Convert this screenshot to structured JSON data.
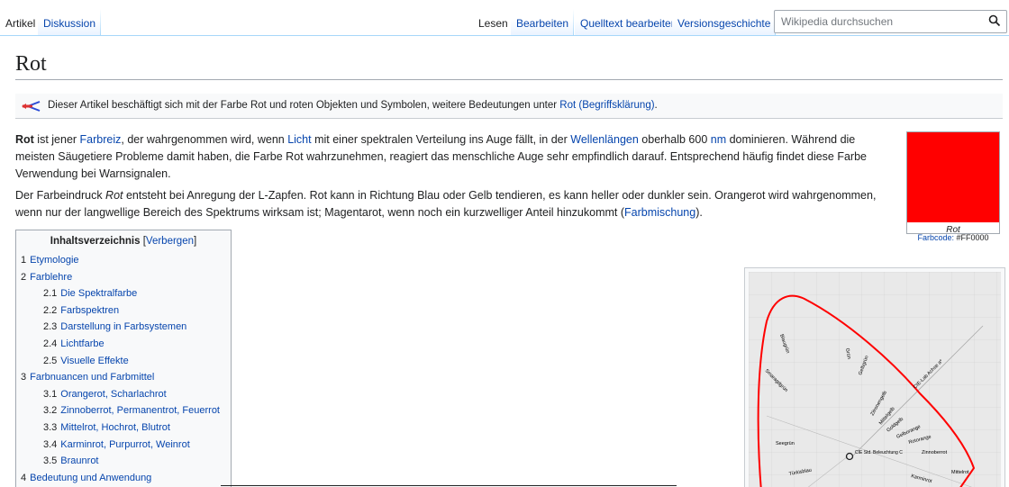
{
  "tabs": {
    "left": [
      {
        "label": "Artikel"
      },
      {
        "label": "Diskussion"
      }
    ],
    "right": [
      {
        "label": "Lesen"
      },
      {
        "label": "Bearbeiten"
      },
      {
        "label": "Quelltext bearbeiten"
      },
      {
        "label": "Versionsgeschichte"
      }
    ]
  },
  "search": {
    "placeholder": "Wikipedia durchsuchen"
  },
  "title": "Rot",
  "hatnote": {
    "text": "Dieser Artikel beschäftigt sich mit der Farbe Rot und roten Objekten und Symbolen, weitere Bedeutungen unter ",
    "link": "Rot (Begriffsklärung)",
    "end": "."
  },
  "p1": {
    "bold": "Rot",
    "t1": " ist jener ",
    "l1": "Farbreiz",
    "t2": ", der wahrgenommen wird, wenn ",
    "l2": "Licht",
    "t3": " mit einer spektralen Verteilung ins Auge fällt, in der ",
    "l3": "Wellenlängen",
    "t4": " oberhalb 600 ",
    "l4": "nm",
    "t5": " dominieren. Während die meisten Säugetiere Probleme damit haben, die Farbe Rot wahrzunehmen, reagiert das menschliche Auge sehr empfindlich darauf. Entsprechend häufig findet diese Farbe Verwendung bei Warnsignalen."
  },
  "p2": {
    "t1": "Der Farbeindruck ",
    "italic": "Rot",
    "t2": " entsteht bei Anregung der L-Zapfen. Rot kann in Richtung Blau oder Gelb tendieren, es kann heller oder dunkler sein. Orangerot wird wahrgenommen, wenn nur der langwellige Bereich des Spektrums wirksam ist; Magentarot, wenn noch ein kurzwelliger Anteil hinzukommt (",
    "l1": "Farbmischung",
    "t3": ")."
  },
  "colorbox": {
    "name": "Rot",
    "code_label": "Farbcode:",
    "code": "#FF0000",
    "color": "#FF0000"
  },
  "toc": {
    "title": "Inhaltsverzeichnis",
    "toggle_open": "[",
    "toggle": "Verbergen",
    "toggle_close": "]",
    "items": [
      {
        "num": "1",
        "label": "Etymologie",
        "level": 1
      },
      {
        "num": "2",
        "label": "Farblehre",
        "level": 1
      },
      {
        "num": "2.1",
        "label": "Die Spektralfarbe",
        "level": 2
      },
      {
        "num": "2.2",
        "label": "Farbspektren",
        "level": 2
      },
      {
        "num": "2.3",
        "label": "Darstellung in Farbsystemen",
        "level": 2
      },
      {
        "num": "2.4",
        "label": "Lichtfarbe",
        "level": 2
      },
      {
        "num": "2.5",
        "label": "Visuelle Effekte",
        "level": 2
      },
      {
        "num": "3",
        "label": "Farbnuancen und Farbmittel",
        "level": 1
      },
      {
        "num": "3.1",
        "label": "Orangerot, Scharlachrot",
        "level": 2
      },
      {
        "num": "3.2",
        "label": "Zinnoberrot, Permanentrot, Feuerrot",
        "level": 2
      },
      {
        "num": "3.3",
        "label": "Mittelrot, Hochrot, Blutrot",
        "level": 2
      },
      {
        "num": "3.4",
        "label": "Karminrot, Purpurrot, Weinrot",
        "level": 2
      },
      {
        "num": "3.5",
        "label": "Braunrot",
        "level": 2
      },
      {
        "num": "4",
        "label": "Bedeutung und Anwendung",
        "level": 1
      }
    ]
  },
  "cie": {
    "labels": [
      "Blaugrün",
      "Smaragdgrün",
      "Seegrün",
      "Türkisblau",
      "Grün",
      "Gelbgrün",
      "Zitronengelb",
      "Mittelgelb",
      "Goldgelb",
      "Gelborange",
      "Rotorange",
      "Zinnoberrot",
      "Mittelrot",
      "Karminrot",
      "CIE Std. Beleuchtung C",
      "CIE-Lab Achse a*"
    ],
    "curve_color": "#FF0000"
  },
  "icons": {
    "hatnote": "disambiguation-arrow-icon",
    "search": "search-icon"
  }
}
